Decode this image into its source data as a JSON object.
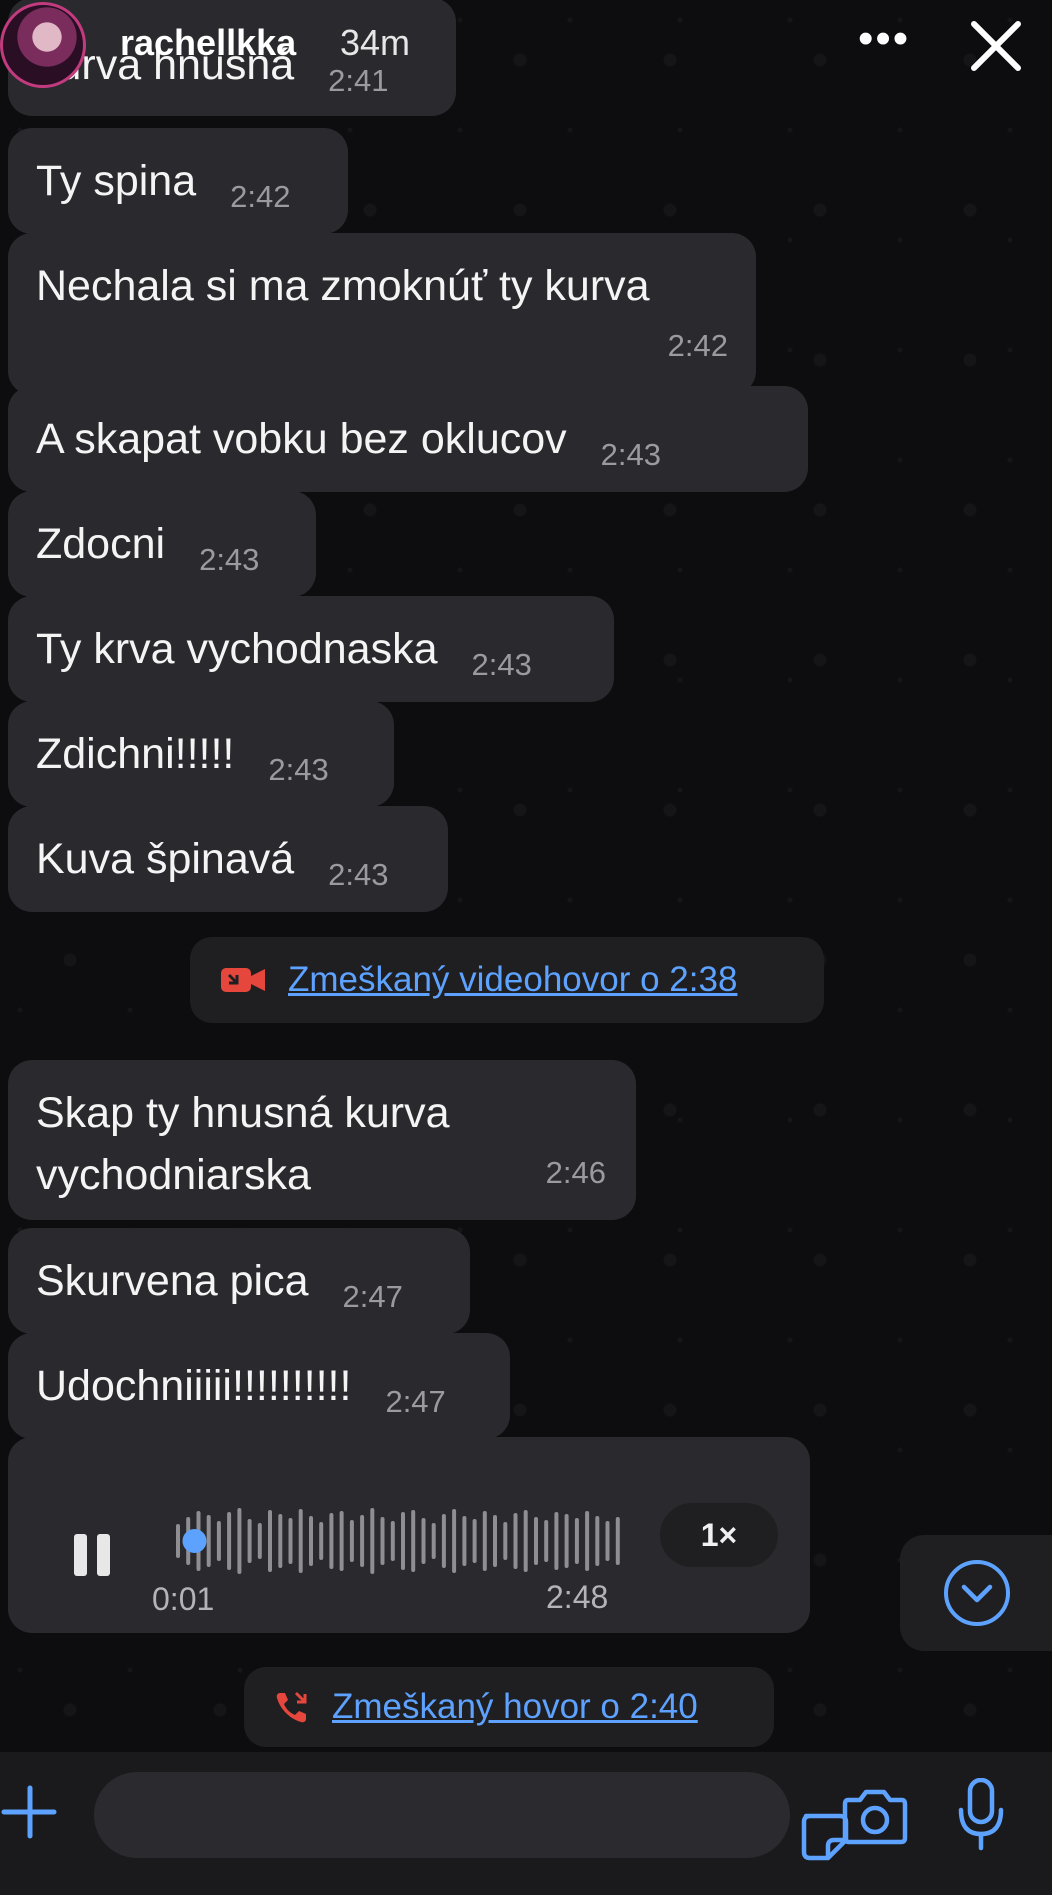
{
  "story": {
    "username": "rachellkka",
    "age": "34m",
    "more_icon": "more-horizontal-icon",
    "close_icon": "close-icon"
  },
  "messages": [
    {
      "text": "kurva hnusná",
      "time": "2:41"
    },
    {
      "text": "Ty spina",
      "time": "2:42"
    },
    {
      "text": "Nechala si ma zmoknúť ty kurva",
      "time": "2:42"
    },
    {
      "text": "A skapat vobku bez oklucov",
      "time": "2:43"
    },
    {
      "text": "Zdocni",
      "time": "2:43"
    },
    {
      "text": "Ty krva vychodnaska",
      "time": "2:43"
    },
    {
      "text": "Zdichni!!!!!",
      "time": "2:43"
    },
    {
      "text": "Kuva špinavá",
      "time": "2:43"
    },
    {
      "text": "Skap ty hnusná kurva vychodniarska",
      "time": "2:46"
    },
    {
      "text": "Skurvena pica",
      "time": "2:47"
    },
    {
      "text": "Udochniiiii!!!!!!!!!!",
      "time": "2:47"
    }
  ],
  "missed_video_call": {
    "label": "Zmeškaný videohovor o 2:38",
    "icon": "missed-video-call-icon",
    "color": "#e5473c"
  },
  "missed_call": {
    "label": "Zmeškaný hovor o 2:40",
    "icon": "missed-call-icon",
    "color": "#e5473c"
  },
  "voice_message": {
    "elapsed": "0:01",
    "time": "2:48",
    "speed": "1×",
    "progress": 0.02
  },
  "colors": {
    "link": "#5ea2ff",
    "accent": "#5ea2ff",
    "bubble": "#2a2a2e"
  }
}
